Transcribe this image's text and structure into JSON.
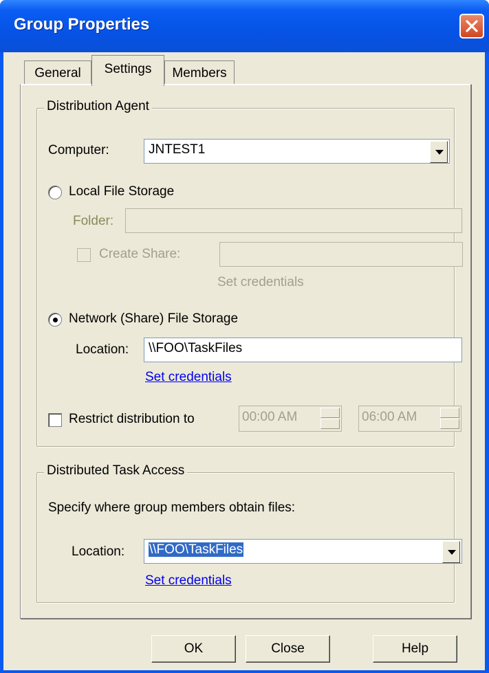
{
  "window": {
    "title": "Group Properties"
  },
  "tabs": [
    {
      "label": "General"
    },
    {
      "label": "Settings"
    },
    {
      "label": "Members"
    }
  ],
  "distribution_agent": {
    "legend": "Distribution Agent",
    "computer_label": "Computer:",
    "computer_value": "JNTEST1",
    "local_storage_label": "Local File Storage",
    "local_storage_selected": false,
    "folder_label": "Folder:",
    "folder_value": "",
    "create_share_label": "Create Share:",
    "create_share_checked": false,
    "create_share_value": "",
    "local_set_credentials": "Set credentials",
    "network_storage_label": "Network (Share) File Storage",
    "network_storage_selected": true,
    "location_label": "Location:",
    "location_value": "\\\\FOO\\TaskFiles",
    "network_set_credentials": "Set credentials",
    "restrict_label": "Restrict distribution to",
    "restrict_checked": false,
    "start_time": "00:00 AM",
    "end_time": "06:00 AM"
  },
  "task_access": {
    "legend": "Distributed Task Access",
    "description": "Specify where group members obtain files:",
    "location_label": "Location:",
    "location_value": "\\\\FOO\\TaskFiles",
    "set_credentials": "Set credentials"
  },
  "buttons": {
    "ok": "OK",
    "close": "Close",
    "help": "Help"
  },
  "colors": {
    "titlebar": "#0a59f0",
    "dialog_bg": "#ece9d8",
    "link": "#0000ee",
    "selection": "#316ac5",
    "close_button": "#d2451f"
  }
}
